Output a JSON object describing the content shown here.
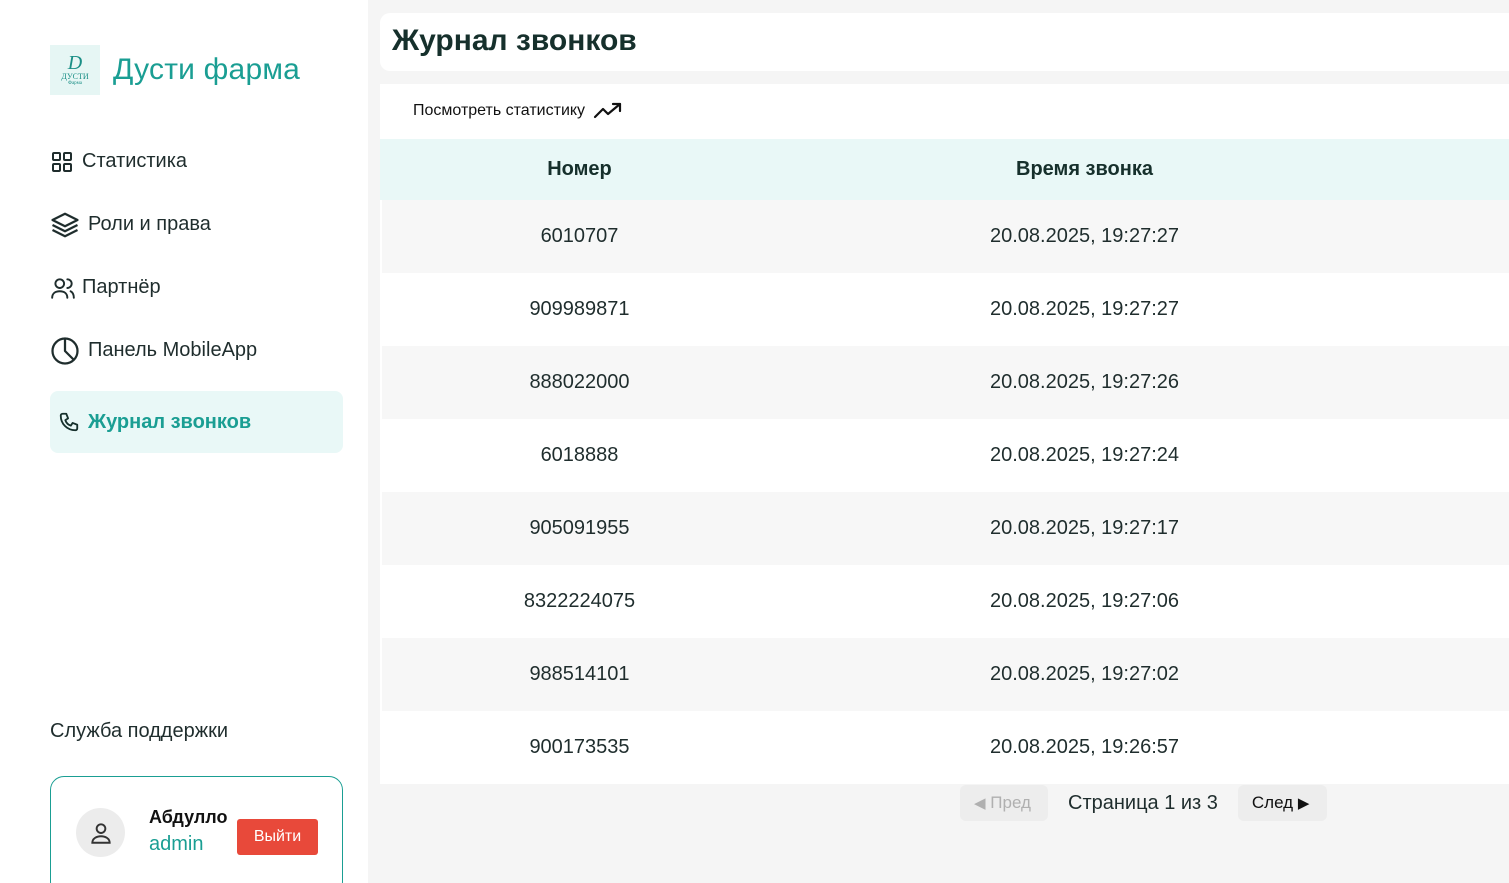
{
  "brand": {
    "name": "Дусти фарма",
    "logo_letter": "D",
    "logo_line1": "ДУСТИ",
    "logo_line2": "Фарма"
  },
  "sidebar": {
    "items": [
      {
        "label": "Статистика",
        "icon": "grid-icon"
      },
      {
        "label": "Роли и права",
        "icon": "layers-icon"
      },
      {
        "label": "Партнёр",
        "icon": "users-icon"
      },
      {
        "label": "Панель MobileApp",
        "icon": "pie-chart-icon"
      },
      {
        "label": "Журнал звонков",
        "icon": "phone-icon",
        "active": true
      }
    ],
    "support_label": "Служба поддержки",
    "user": {
      "name": "Абдулло",
      "role": "admin",
      "logout_label": "Выйти"
    }
  },
  "header": {
    "title": "Журнал звонков"
  },
  "main": {
    "stats_link": "Посмотреть статистику",
    "columns": [
      "Номер",
      "Время звонка"
    ],
    "rows": [
      [
        "6010707",
        "20.08.2025, 19:27:27"
      ],
      [
        "909989871",
        "20.08.2025, 19:27:27"
      ],
      [
        "888022000",
        "20.08.2025, 19:27:26"
      ],
      [
        "6018888",
        "20.08.2025, 19:27:24"
      ],
      [
        "905091955",
        "20.08.2025, 19:27:17"
      ],
      [
        "8322224075",
        "20.08.2025, 19:27:06"
      ],
      [
        "988514101",
        "20.08.2025, 19:27:02"
      ],
      [
        "900173535",
        "20.08.2025, 19:26:57"
      ]
    ]
  },
  "pagination": {
    "prev_label": "Пред",
    "next_label": "След",
    "page_info": "Страница 1 из 3"
  },
  "colors": {
    "accent": "#1a9e93",
    "active_bg": "#e9f8f7",
    "logout": "#e8493a"
  }
}
